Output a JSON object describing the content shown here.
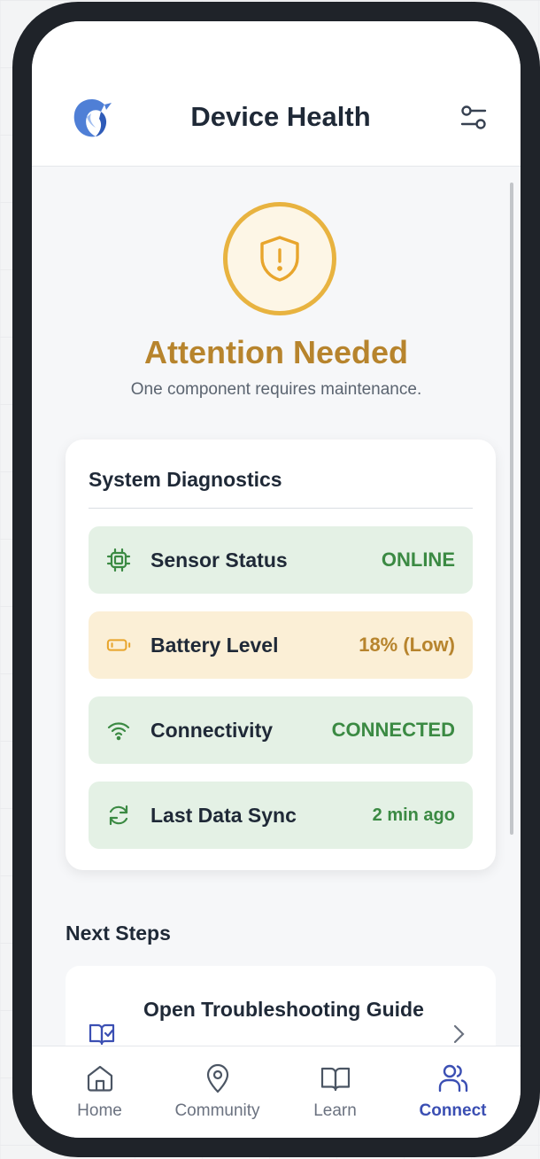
{
  "header": {
    "title": "Device Health",
    "logo_icon": "bird-logo-icon",
    "filter_icon": "sliders-icon"
  },
  "status": {
    "icon": "shield-alert-icon",
    "title": "Attention Needed",
    "subtitle": "One component requires maintenance.",
    "color": "#b7842d"
  },
  "diagnostics": {
    "title": "System Diagnostics",
    "rows": [
      {
        "icon": "chip-icon",
        "label": "Sensor Status",
        "value": "ONLINE",
        "state": "ok"
      },
      {
        "icon": "battery-low-icon",
        "label": "Battery Level",
        "value": "18% (Low)",
        "state": "warn"
      },
      {
        "icon": "wifi-icon",
        "label": "Connectivity",
        "value": "CONNECTED",
        "state": "ok"
      },
      {
        "icon": "sync-icon",
        "label": "Last Data Sync",
        "value": "2 min ago",
        "state": "ok"
      }
    ]
  },
  "next_steps": {
    "title": "Next Steps",
    "items": [
      {
        "icon": "book-check-icon",
        "label": "Open Troubleshooting Guide"
      }
    ]
  },
  "tabs": [
    {
      "icon": "home-icon",
      "label": "Home",
      "active": false
    },
    {
      "icon": "map-pin-icon",
      "label": "Community",
      "active": false
    },
    {
      "icon": "book-open-icon",
      "label": "Learn",
      "active": false
    },
    {
      "icon": "users-icon",
      "label": "Connect",
      "active": true
    }
  ],
  "colors": {
    "ok_bg": "#e4f1e5",
    "ok_text": "#3b8a43",
    "warn_bg": "#fbefd6",
    "warn_text": "#b7842d",
    "accent": "#3b4fb3"
  }
}
